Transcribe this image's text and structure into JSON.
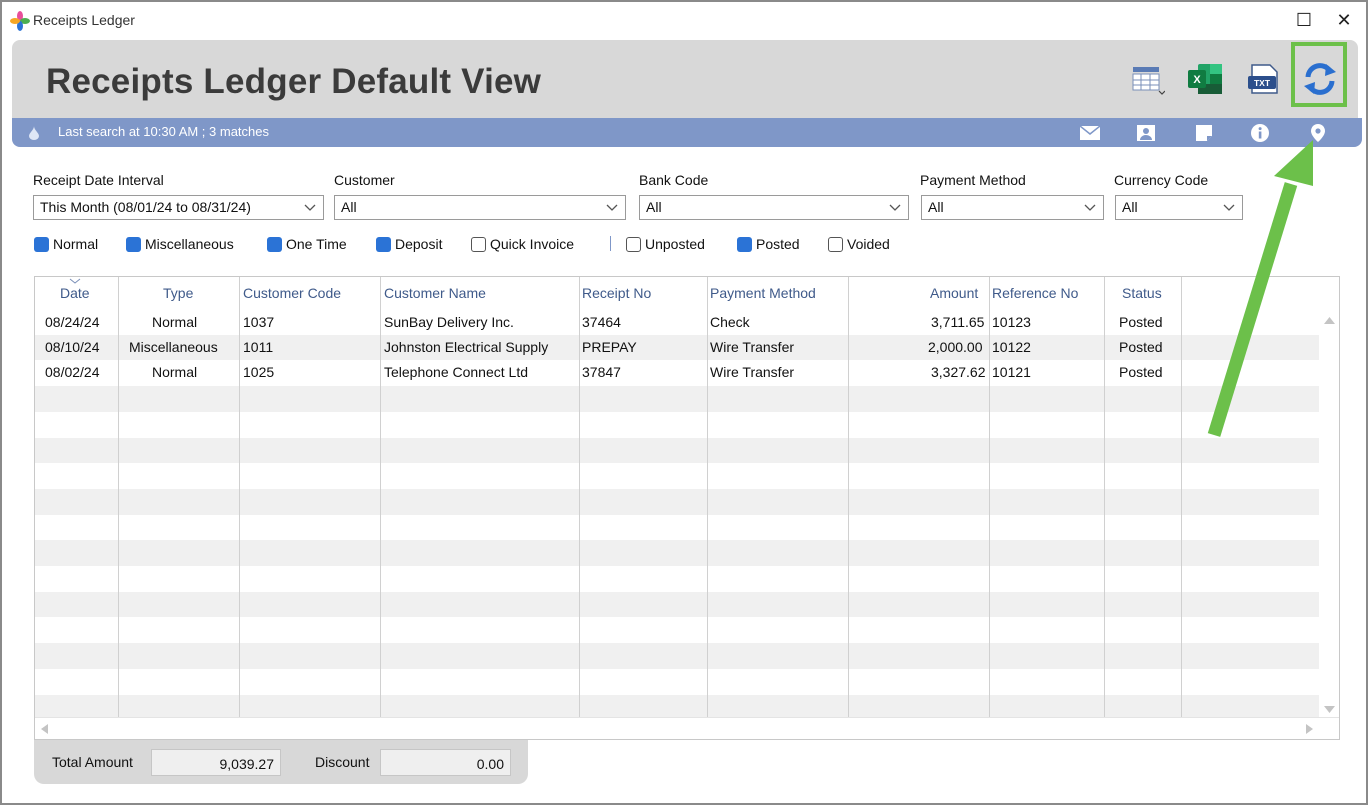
{
  "window": {
    "title": "Receipts Ledger",
    "maximize": "☐",
    "close": "✕"
  },
  "header": {
    "title": "Receipts Ledger Default View"
  },
  "status": {
    "text": "Last search at 10:30 AM ; 3 matches"
  },
  "filters": {
    "date_interval": {
      "label": "Receipt Date Interval",
      "value": "This Month (08/01/24 to 08/31/24)"
    },
    "customer": {
      "label": "Customer",
      "value": "All"
    },
    "bank_code": {
      "label": "Bank Code",
      "value": "All"
    },
    "payment_method": {
      "label": "Payment Method",
      "value": "All"
    },
    "currency_code": {
      "label": "Currency Code",
      "value": "All"
    }
  },
  "checkboxes": [
    {
      "label": "Normal",
      "checked": true
    },
    {
      "label": "Miscellaneous",
      "checked": true
    },
    {
      "label": "One Time",
      "checked": true
    },
    {
      "label": "Deposit",
      "checked": true
    },
    {
      "label": "Quick Invoice",
      "checked": false
    },
    {
      "label": "Unposted",
      "checked": false
    },
    {
      "label": "Posted",
      "checked": true
    },
    {
      "label": "Voided",
      "checked": false
    }
  ],
  "grid": {
    "columns": [
      "Date",
      "Type",
      "Customer Code",
      "Customer Name",
      "Receipt No",
      "Payment Method",
      "Amount",
      "Reference No",
      "Status"
    ],
    "rows": [
      [
        "08/24/24",
        "Normal",
        "1037",
        "SunBay Delivery Inc.",
        "37464",
        "Check",
        "3,711.65",
        "10123",
        "Posted"
      ],
      [
        "08/10/24",
        "Miscellaneous",
        "1011",
        "Johnston Electrical Supply",
        "PREPAY",
        "Wire Transfer",
        "2,000.00",
        "10122",
        "Posted"
      ],
      [
        "08/02/24",
        "Normal",
        "1025",
        "Telephone Connect Ltd",
        "37847",
        "Wire Transfer",
        "3,327.62",
        "10121",
        "Posted"
      ]
    ]
  },
  "footer": {
    "total_label": "Total Amount",
    "total_value": "9,039.27",
    "discount_label": "Discount",
    "discount_value": "0.00"
  },
  "colors": {
    "accent_bar": "#7f97c8",
    "header_bg": "#d8d8d8",
    "checkbox": "#2b73d6",
    "highlight": "#6cc04a",
    "excel": "#1d7a45",
    "refresh": "#2a6fcf"
  },
  "icons": [
    "grid-layout-icon",
    "excel-icon",
    "txt-export-icon",
    "refresh-icon",
    "drop-icon",
    "mail-icon",
    "contact-icon",
    "note-icon",
    "info-icon",
    "location-pin-icon"
  ]
}
